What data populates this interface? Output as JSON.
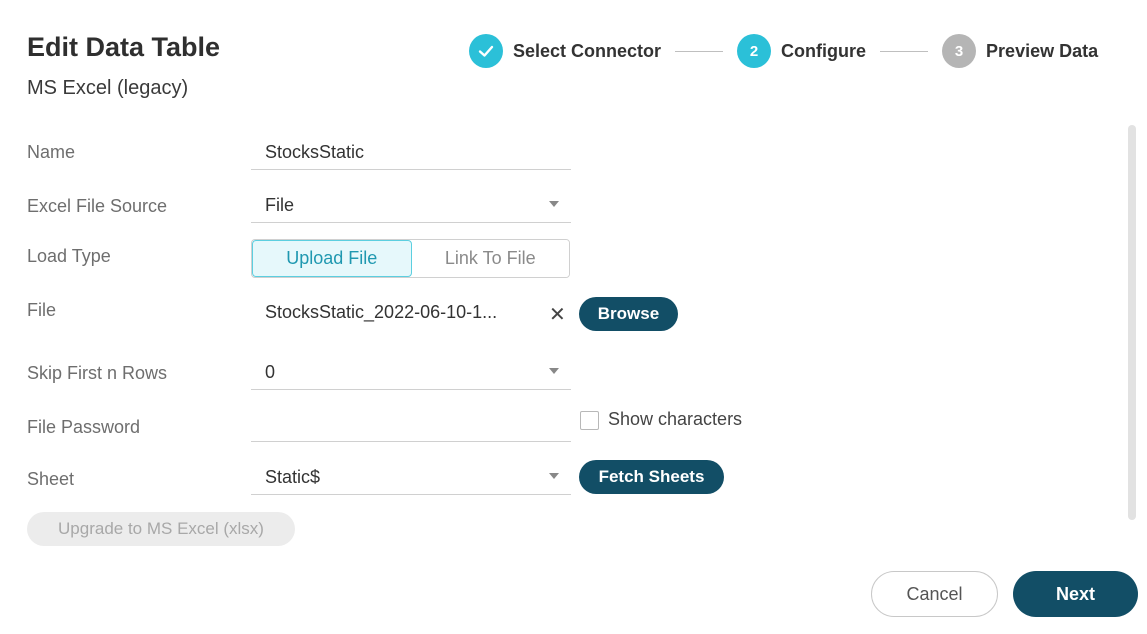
{
  "dialog": {
    "title": "Edit Data Table",
    "subtitle": "MS Excel (legacy)"
  },
  "steps": [
    {
      "number": "",
      "label": "Select Connector",
      "state": "completed",
      "icon": "check-icon"
    },
    {
      "number": "2",
      "label": "Configure",
      "state": "active"
    },
    {
      "number": "3",
      "label": "Preview Data",
      "state": "pending"
    }
  ],
  "form": {
    "name": {
      "label": "Name",
      "value": "StocksStatic"
    },
    "excel_file_source": {
      "label": "Excel File Source",
      "value": "File"
    },
    "load_type": {
      "label": "Load Type",
      "options": [
        "Upload File",
        "Link To File"
      ],
      "selected": "Upload File"
    },
    "file": {
      "label": "File",
      "value": "StocksStatic_2022-06-10-1...",
      "clear_icon": "close-icon",
      "browse_label": "Browse"
    },
    "skip_first_n_rows": {
      "label": "Skip First n Rows",
      "value": "0"
    },
    "file_password": {
      "label": "File Password",
      "value": "",
      "show_characters_label": "Show characters",
      "show_characters_checked": false
    },
    "sheet": {
      "label": "Sheet",
      "value": "Static$",
      "fetch_label": "Fetch Sheets"
    },
    "upgrade_label": "Upgrade to MS Excel (xlsx)"
  },
  "footer": {
    "cancel_label": "Cancel",
    "next_label": "Next"
  },
  "colors": {
    "accent": "#2bc0d8",
    "primary": "#124e66",
    "pending": "#b5b5b5"
  }
}
